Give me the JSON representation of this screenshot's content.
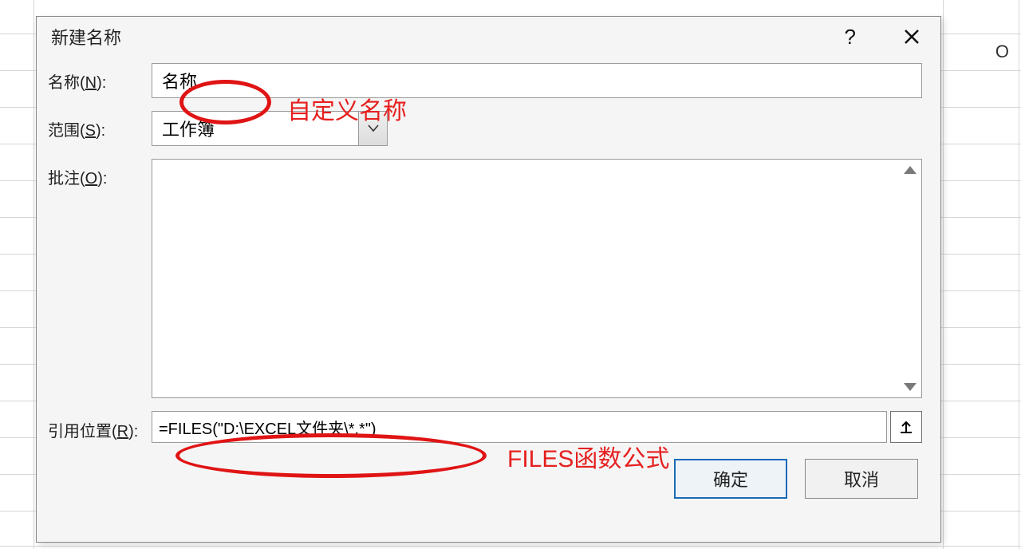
{
  "spreadsheet": {
    "column_header": "O"
  },
  "dialog": {
    "title": "新建名称",
    "help_symbol": "?",
    "labels": {
      "name_prefix": "名称(",
      "name_key": "N",
      "name_suffix": "):",
      "scope_prefix": "范围(",
      "scope_key": "S",
      "scope_suffix": "):",
      "comment_prefix": "批注(",
      "comment_key": "O",
      "comment_suffix": "):",
      "ref_prefix": "引用位置(",
      "ref_key": "R",
      "ref_suffix": "):"
    },
    "fields": {
      "name_value": "名称",
      "scope_value": "工作簿",
      "comment_value": "",
      "ref_value": "=FILES(\"D:\\EXCEL文件夹\\*.*\")"
    },
    "buttons": {
      "ok": "确定",
      "cancel": "取消"
    }
  },
  "annotations": {
    "name_hint": "自定义名称",
    "ref_hint": "FILES函数公式"
  }
}
